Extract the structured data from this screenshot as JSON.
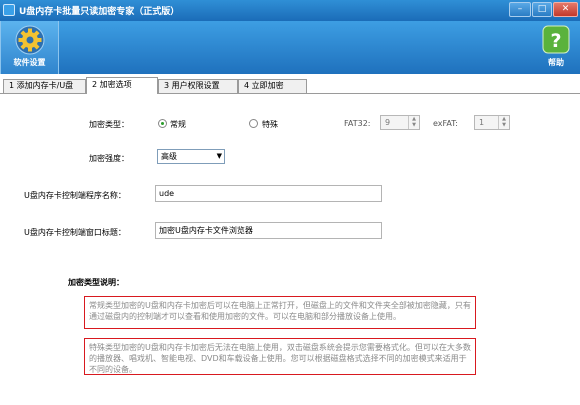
{
  "window": {
    "title": "U盘内存卡批量只读加密专家（正式版）",
    "min": "–",
    "max": "□",
    "close": "✕"
  },
  "toolbar": {
    "settings_label": "软件设置",
    "help_label": "帮助"
  },
  "tabs": [
    {
      "label": "1 添加内存卡/U盘"
    },
    {
      "label": "2 加密选项"
    },
    {
      "label": "3 用户权限设置"
    },
    {
      "label": "4 立即加密"
    }
  ],
  "form": {
    "enc_type_label": "加密类型：",
    "radio_normal": "常规",
    "radio_special": "特殊",
    "fat32_label": "FAT32:",
    "fat32_value": "9",
    "exfat_label": "exFAT:",
    "exfat_value": "1",
    "strength_label": "加密强度：",
    "strength_value": "高级",
    "program_name_label": "U盘内存卡控制端程序名称：",
    "program_name_value": "ude",
    "window_title_label": "U盘内存卡控制端窗口标题：",
    "window_title_value": "加密U盘内存卡文件浏览器"
  },
  "description": {
    "heading": "加密类型说明：",
    "normal_text": "常规类型加密的U盘和内存卡加密后可以在电脑上正常打开，但磁盘上的文件和文件夹全部被加密隐藏，只有通过磁盘内的控制端才可以查看和使用加密的文件。可以在电脑和部分播放设备上使用。",
    "special_text": "特殊类型加密的U盘和内存卡加密后无法在电脑上使用，双击磁盘系统会提示您需要格式化。但可以在大多数的播放器、唱戏机、智能电视、DVD和车载设备上使用。您可以根据磁盘格式选择不同的加密模式来适用于不同的设备。"
  },
  "icons": {
    "settings": "gear-icon",
    "help": "help-icon"
  },
  "colors": {
    "accent": "#1f71bd",
    "border_red": "#d8191f",
    "radio_green": "#2a9d2a"
  }
}
